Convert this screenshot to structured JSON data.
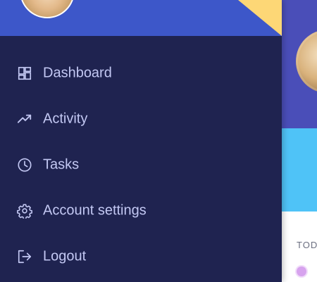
{
  "drawer": {
    "menu": [
      {
        "label": "Dashboard",
        "icon": "dashboard-icon"
      },
      {
        "label": "Activity",
        "icon": "trending-up-icon"
      },
      {
        "label": "Tasks",
        "icon": "clock-icon"
      },
      {
        "label": "Account settings",
        "icon": "gear-icon"
      },
      {
        "label": "Logout",
        "icon": "logout-icon"
      }
    ]
  },
  "background": {
    "section_label": "TODA"
  },
  "colors": {
    "drawer_bg": "#1f2350",
    "header_blue": "#3d57c9",
    "header_corner_yellow": "#fdd776",
    "menu_text": "#c3c8f3",
    "bg_purple": "#4a4eb8",
    "bg_cyan": "#4fc3f7"
  }
}
